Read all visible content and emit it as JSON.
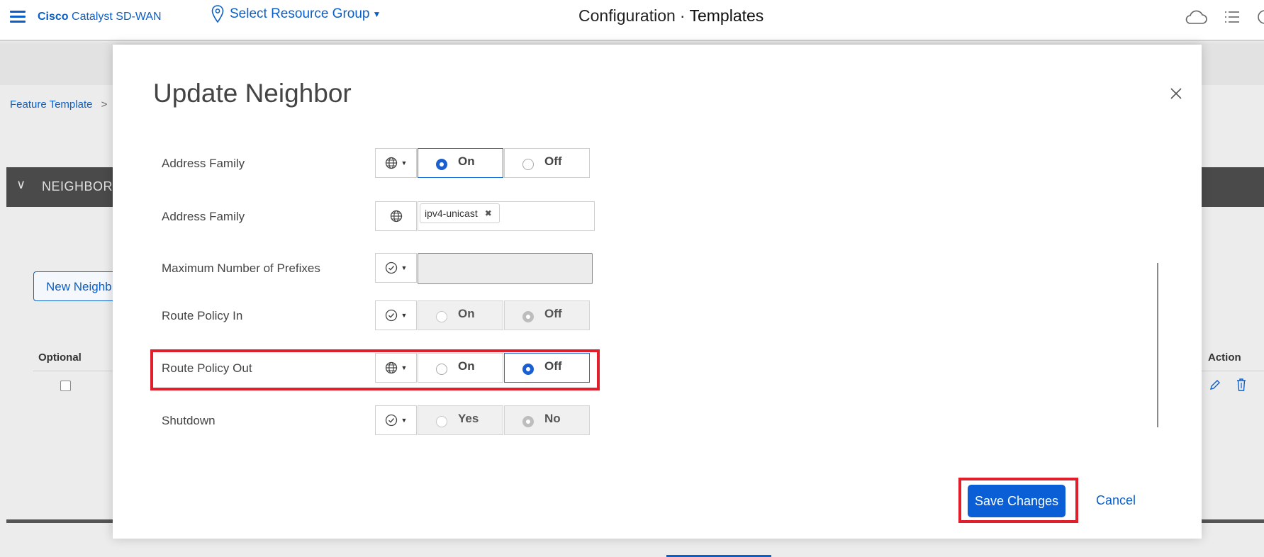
{
  "header": {
    "brand_bold": "Cisco",
    "brand_rest": "Catalyst SD-WAN",
    "resource_group": "Select Resource Group",
    "title_section": "Configuration",
    "title_separator": "·",
    "title_page": "Templates"
  },
  "background": {
    "breadcrumb": "Feature Template",
    "breadcrumb_sep": ">",
    "neighbor_section": "NEIGHBOR",
    "new_neighbor_button": "New Neighb",
    "col_optional": "Optional",
    "col_action": "Action"
  },
  "modal": {
    "title": "Update Neighbor",
    "rows": [
      {
        "label": "Address Family",
        "scope": "global",
        "type": "toggle",
        "on": "On",
        "off": "Off",
        "selected": "On"
      },
      {
        "label": "Address Family",
        "scope": "global",
        "type": "tags",
        "tags": [
          "ipv4-unicast"
        ]
      },
      {
        "label": "Maximum Number of Prefixes",
        "scope": "default",
        "type": "text",
        "value": ""
      },
      {
        "label": "Route Policy In",
        "scope": "default",
        "type": "toggle",
        "on": "On",
        "off": "Off",
        "selected": "Off"
      },
      {
        "label": "Route Policy Out",
        "scope": "global",
        "type": "toggle",
        "on": "On",
        "off": "Off",
        "selected": "Off"
      },
      {
        "label": "Shutdown",
        "scope": "default",
        "type": "toggle",
        "on": "Yes",
        "off": "No",
        "selected": "No"
      }
    ],
    "save_label": "Save Changes",
    "cancel_label": "Cancel"
  },
  "colors": {
    "accent": "#0b5fc6",
    "highlight": "#e01f2b",
    "primary_button": "#0b5fd6"
  }
}
